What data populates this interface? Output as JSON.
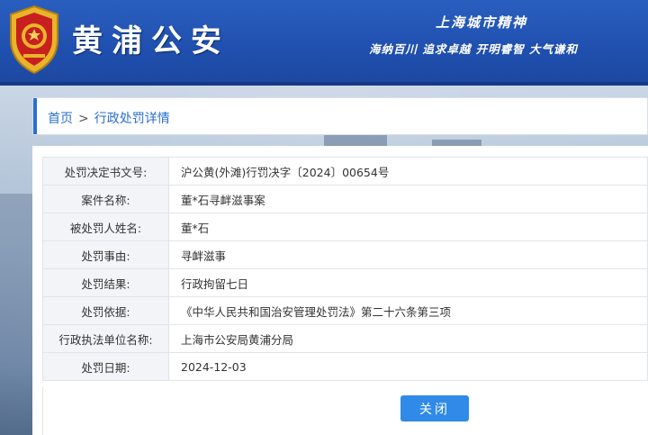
{
  "header": {
    "site_title": "黄浦公安",
    "slogan_title": "上海城市精神",
    "slogan_text": "海纳百川 追求卓越 开明睿智 大气谦和"
  },
  "breadcrumb": {
    "home": "首页",
    "separator": ">",
    "current": "行政处罚详情"
  },
  "details": [
    {
      "label": "处罚决定书文号:",
      "value": "沪公黄(外滩)行罚决字〔2024〕00654号"
    },
    {
      "label": "案件名称:",
      "value": "董*石寻衅滋事案"
    },
    {
      "label": "被处罚人姓名:",
      "value": "董*石"
    },
    {
      "label": "处罚事由:",
      "value": "寻衅滋事"
    },
    {
      "label": "处罚结果:",
      "value": "行政拘留七日"
    },
    {
      "label": "处罚依据:",
      "value": "《中华人民共和国治安管理处罚法》第二十六条第三项"
    },
    {
      "label": "行政执法单位名称:",
      "value": "上海市公安局黄浦分局"
    },
    {
      "label": "处罚日期:",
      "value": "2024-12-03"
    }
  ],
  "actions": {
    "close_label": "关闭"
  },
  "colors": {
    "header_blue": "#1f4fae",
    "link_blue": "#2a6fd0",
    "button_blue": "#2f8ae8",
    "label_bg": "#f2f4f7"
  }
}
